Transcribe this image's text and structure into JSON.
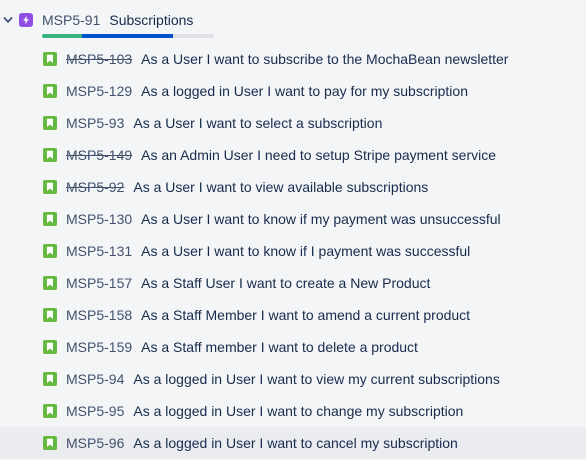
{
  "epic": {
    "key": "MSP5-91",
    "title": "Subscriptions",
    "progress": {
      "done_fraction": 0.23,
      "in_progress_fraction": 0.53
    },
    "colors": {
      "epic_icon": "#904ee2",
      "done": "#36b37e",
      "in_progress": "#0052cc",
      "todo": "#dfe1e6"
    }
  },
  "story_icon": {
    "name": "story-bookmark-icon",
    "color": "#63ba3c"
  },
  "issues": [
    {
      "key": "MSP5-103",
      "summary": "As a User I want to subscribe to the MochaBean newsletter",
      "done": true
    },
    {
      "key": "MSP5-129",
      "summary": "As a logged in User I want to pay for my subscription",
      "done": false
    },
    {
      "key": "MSP5-93",
      "summary": "As a User I want to select a subscription",
      "done": false
    },
    {
      "key": "MSP5-149",
      "summary": "As an Admin User I need to setup Stripe payment service",
      "done": true
    },
    {
      "key": "MSP5-92",
      "summary": "As a User I want to view available subscriptions",
      "done": true
    },
    {
      "key": "MSP5-130",
      "summary": "As a User I want to know if my payment was unsuccessful",
      "done": false
    },
    {
      "key": "MSP5-131",
      "summary": "As a User I want to know if I payment was successful",
      "done": false
    },
    {
      "key": "MSP5-157",
      "summary": "As a Staff User I want to create a New Product",
      "done": false
    },
    {
      "key": "MSP5-158",
      "summary": "As a Staff Member I want to amend a current product",
      "done": false
    },
    {
      "key": "MSP5-159",
      "summary": "As a Staff member I want to delete a product",
      "done": false
    },
    {
      "key": "MSP5-94",
      "summary": "As a logged in User I want to view my current subscriptions",
      "done": false
    },
    {
      "key": "MSP5-95",
      "summary": "As a logged in User I want to change my subscription",
      "done": false
    },
    {
      "key": "MSP5-96",
      "summary": "As a logged in User I want to cancel my subscription",
      "done": false,
      "highlighted": true
    }
  ]
}
